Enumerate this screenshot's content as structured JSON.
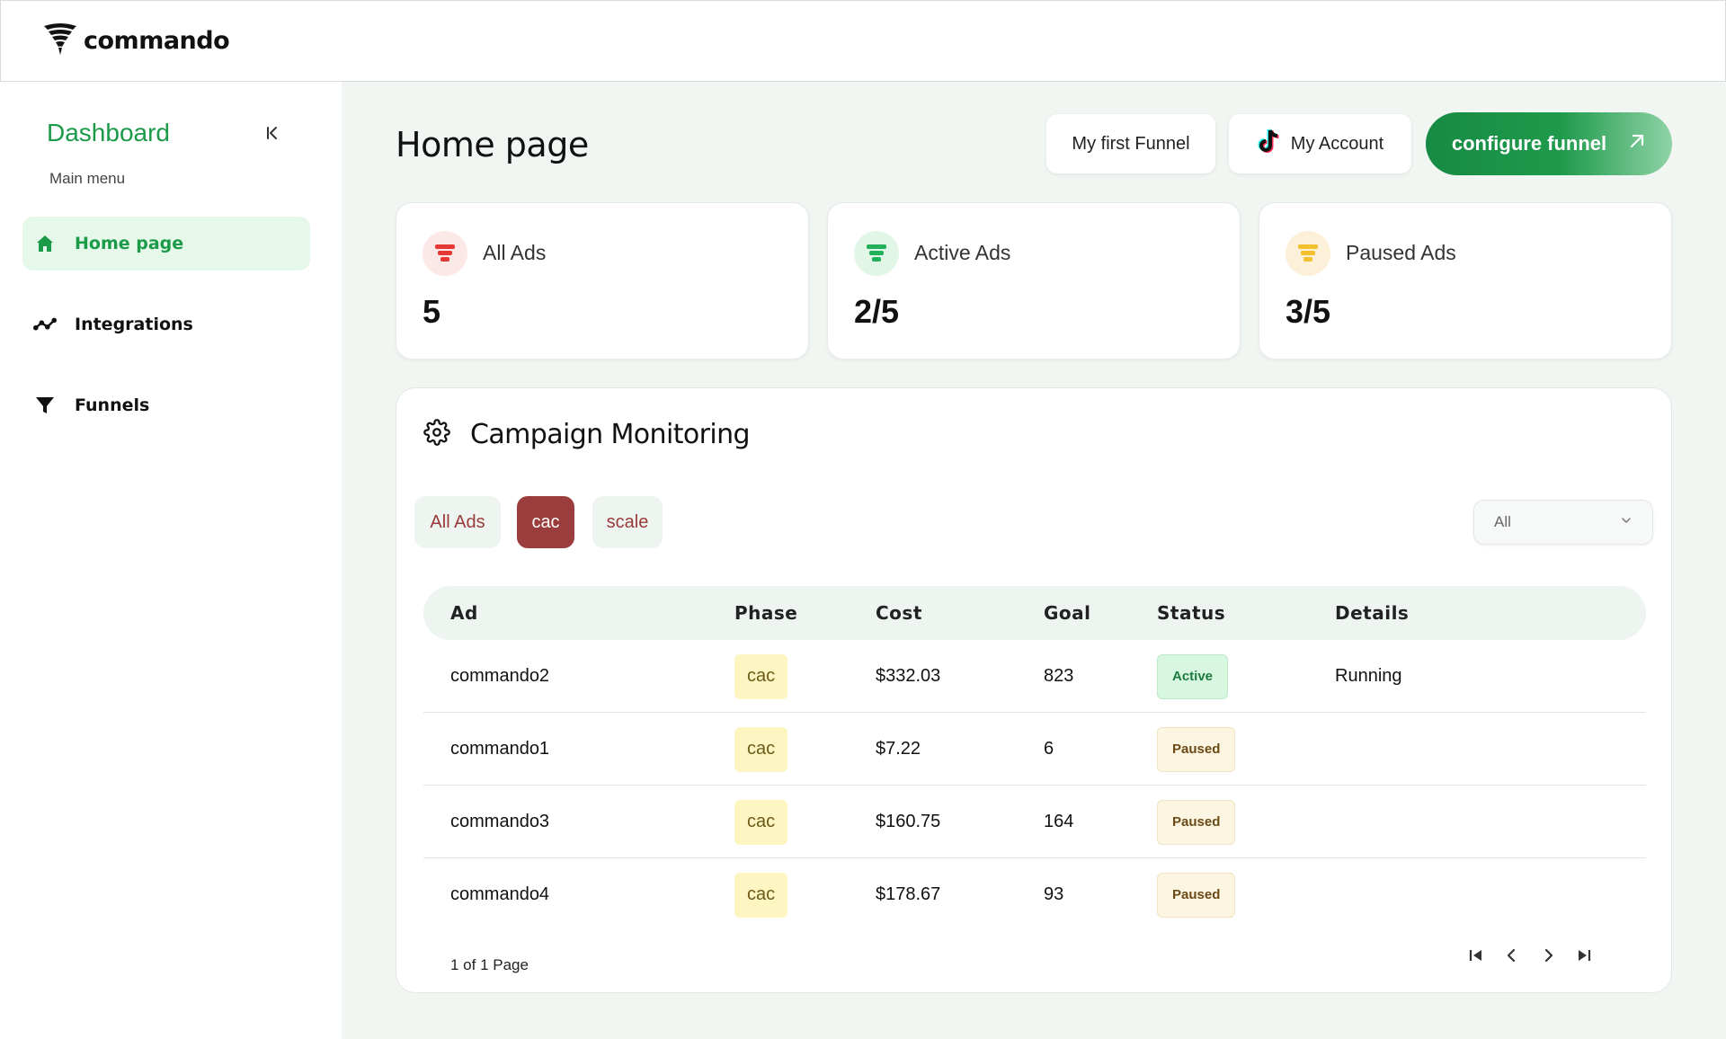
{
  "app": {
    "logo_text": "commando"
  },
  "sidebar": {
    "title": "Dashboard",
    "subtitle": "Main menu",
    "items": [
      {
        "label": "Home page",
        "icon": "home-icon",
        "active": true
      },
      {
        "label": "Integrations",
        "icon": "integrations-icon",
        "active": false
      },
      {
        "label": "Funnels",
        "icon": "funnel-icon",
        "active": false
      }
    ]
  },
  "header": {
    "title": "Home page",
    "funnel_button": "My first Funnel",
    "account_button": "My Account",
    "configure_button": "configure funnel"
  },
  "stats": [
    {
      "label": "All Ads",
      "value": "5",
      "color": "#e53935",
      "bg": "#fde8e8"
    },
    {
      "label": "Active Ads",
      "value": "2/5",
      "color": "#22b05a",
      "bg": "#e2f6e8"
    },
    {
      "label": "Paused Ads",
      "value": "3/5",
      "color": "#f3c12b",
      "bg": "#fdf0d9"
    }
  ],
  "campaign": {
    "title": "Campaign Monitoring",
    "filters": [
      {
        "label": "All Ads",
        "selected": false
      },
      {
        "label": "cac",
        "selected": true
      },
      {
        "label": "scale",
        "selected": false
      }
    ],
    "select_value": "All",
    "columns": [
      "Ad",
      "Phase",
      "Cost",
      "Goal",
      "Status",
      "Details"
    ],
    "rows": [
      {
        "ad": "commando2",
        "phase": "cac",
        "cost": "$332.03",
        "goal": "823",
        "status": "Active",
        "details": "Running"
      },
      {
        "ad": "commando1",
        "phase": "cac",
        "cost": "$7.22",
        "goal": "6",
        "status": "Paused",
        "details": ""
      },
      {
        "ad": "commando3",
        "phase": "cac",
        "cost": "$160.75",
        "goal": "164",
        "status": "Paused",
        "details": ""
      },
      {
        "ad": "commando4",
        "phase": "cac",
        "cost": "$178.67",
        "goal": "93",
        "status": "Paused",
        "details": ""
      }
    ],
    "pagination": "1 of 1 Page"
  }
}
